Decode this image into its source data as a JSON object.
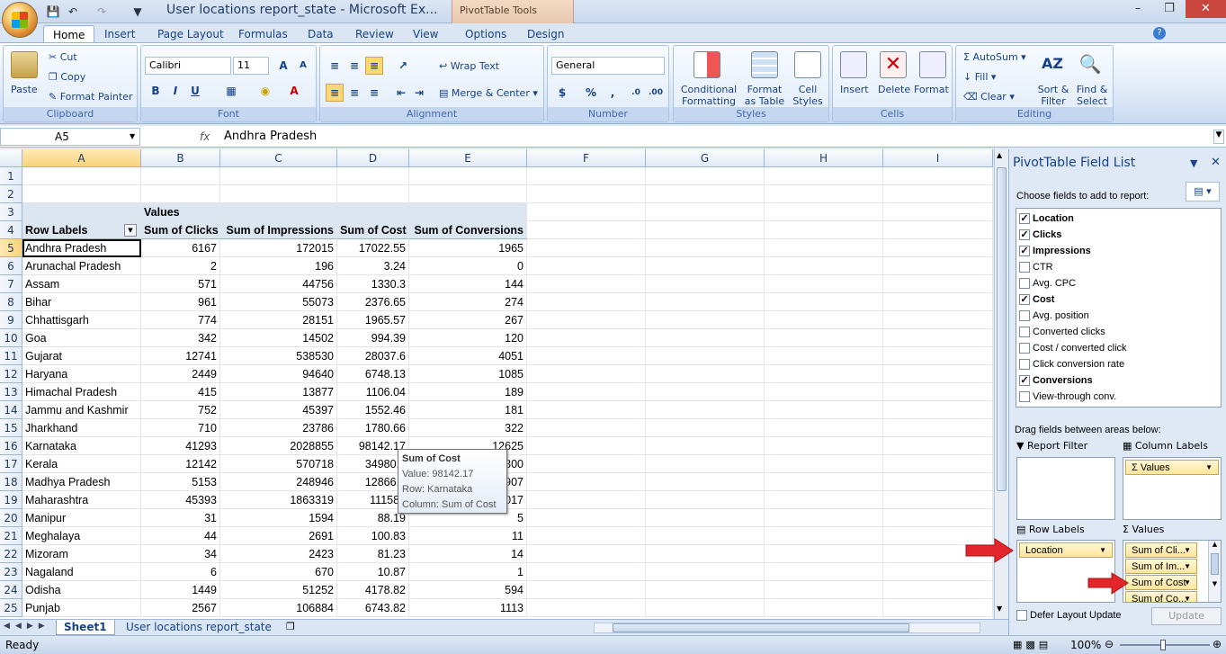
{
  "app": {
    "title": "User locations report_state - Microsoft Ex...",
    "context_tab": "PivotTable Tools"
  },
  "tabs": [
    "Home",
    "Insert",
    "Page Layout",
    "Formulas",
    "Data",
    "Review",
    "View",
    "Options",
    "Design"
  ],
  "ribbon": {
    "clipboard": {
      "label": "Clipboard",
      "paste": "Paste",
      "cut": "Cut",
      "copy": "Copy",
      "format_painter": "Format Painter"
    },
    "font": {
      "label": "Font",
      "family": "Calibri",
      "size": "11"
    },
    "alignment": {
      "label": "Alignment",
      "wrap": "Wrap Text",
      "merge": "Merge & Center"
    },
    "number": {
      "label": "Number",
      "format": "General"
    },
    "styles": {
      "label": "Styles",
      "conditional": "Conditional",
      "conditional2": "Formatting",
      "format_table": "Format",
      "format_table2": "as Table",
      "cell_styles": "Cell",
      "cell_styles2": "Styles"
    },
    "cells": {
      "label": "Cells",
      "insert": "Insert",
      "delete": "Delete",
      "format": "Format"
    },
    "editing": {
      "label": "Editing",
      "autosum": "AutoSum",
      "fill": "Fill",
      "clear": "Clear",
      "sort": "Sort &",
      "sort2": "Filter",
      "find": "Find &",
      "find2": "Select"
    }
  },
  "formula_bar": {
    "cell_ref": "A5",
    "fx": "fx",
    "value": "Andhra Pradesh"
  },
  "columns": [
    "A",
    "B",
    "C",
    "D",
    "E",
    "F",
    "G",
    "H",
    "I"
  ],
  "rows": [
    "1",
    "2",
    "3",
    "4",
    "5",
    "6",
    "7",
    "8",
    "9",
    "10",
    "11",
    "12",
    "13",
    "14",
    "15",
    "16",
    "17",
    "18",
    "19",
    "20",
    "21",
    "22",
    "23",
    "24",
    "25"
  ],
  "pivot": {
    "values_label": "Values",
    "row_labels": "Row Labels",
    "headers": [
      "Sum of Clicks",
      "Sum of Impressions",
      "Sum of Cost",
      "Sum of Conversions"
    ],
    "data": [
      [
        "Andhra Pradesh",
        "6167",
        "172015",
        "17022.55",
        "1965"
      ],
      [
        "Arunachal Pradesh",
        "2",
        "196",
        "3.24",
        "0"
      ],
      [
        "Assam",
        "571",
        "44756",
        "1330.3",
        "144"
      ],
      [
        "Bihar",
        "961",
        "55073",
        "2376.65",
        "274"
      ],
      [
        "Chhattisgarh",
        "774",
        "28151",
        "1965.57",
        "267"
      ],
      [
        "Goa",
        "342",
        "14502",
        "994.39",
        "120"
      ],
      [
        "Gujarat",
        "12741",
        "538530",
        "28037.6",
        "4051"
      ],
      [
        "Haryana",
        "2449",
        "94640",
        "6748.13",
        "1085"
      ],
      [
        "Himachal Pradesh",
        "415",
        "13877",
        "1106.04",
        "189"
      ],
      [
        "Jammu and Kashmir",
        "752",
        "45397",
        "1552.46",
        "181"
      ],
      [
        "Jharkhand",
        "710",
        "23786",
        "1780.66",
        "322"
      ],
      [
        "Karnataka",
        "41293",
        "2028855",
        "98142.17",
        "12625"
      ],
      [
        "Kerala",
        "12142",
        "570718",
        "34980.2",
        "300"
      ],
      [
        "Madhya Pradesh",
        "5153",
        "248946",
        "12866.0",
        "907"
      ],
      [
        "Maharashtra",
        "45393",
        "1863319",
        "111587",
        "017"
      ],
      [
        "Manipur",
        "31",
        "1594",
        "88.19",
        "5"
      ],
      [
        "Meghalaya",
        "44",
        "2691",
        "100.83",
        "11"
      ],
      [
        "Mizoram",
        "34",
        "2423",
        "81.23",
        "14"
      ],
      [
        "Nagaland",
        "6",
        "670",
        "10.87",
        "1"
      ],
      [
        "Odisha",
        "1449",
        "51252",
        "4178.82",
        "594"
      ],
      [
        "Punjab",
        "2567",
        "106884",
        "6743.82",
        "1113"
      ]
    ]
  },
  "tooltip": {
    "title": "Sum of Cost",
    "value": "Value: 98142.17",
    "row": "Row: Karnataka",
    "column": "Column: Sum of Cost"
  },
  "sheets": [
    "Sheet1",
    "User locations report_state"
  ],
  "status": {
    "ready": "Ready",
    "zoom": "100%"
  },
  "field_list": {
    "title": "PivotTable Field List",
    "choose": "Choose fields to add to report:",
    "fields": [
      {
        "name": "Location",
        "checked": true
      },
      {
        "name": "Clicks",
        "checked": true
      },
      {
        "name": "Impressions",
        "checked": true
      },
      {
        "name": "CTR",
        "checked": false
      },
      {
        "name": "Avg. CPC",
        "checked": false
      },
      {
        "name": "Cost",
        "checked": true
      },
      {
        "name": "Avg. position",
        "checked": false
      },
      {
        "name": "Converted clicks",
        "checked": false
      },
      {
        "name": "Cost / converted click",
        "checked": false
      },
      {
        "name": "Click conversion rate",
        "checked": false
      },
      {
        "name": "Conversions",
        "checked": true
      },
      {
        "name": "View-through conv.",
        "checked": false
      }
    ],
    "drag_text": "Drag fields between areas below:",
    "report_filter": "Report Filter",
    "column_labels": "Column Labels",
    "row_labels": "Row Labels",
    "values": "Values",
    "col_item": "Values",
    "row_item": "Location",
    "value_items": [
      "Sum of Cli...",
      "Sum of Im...",
      "Sum of Cost",
      "Sum of Co..."
    ],
    "defer": "Defer Layout Update",
    "update": "Update"
  },
  "colors": {
    "accent": "#15428b",
    "arrow": "#e3262b"
  }
}
